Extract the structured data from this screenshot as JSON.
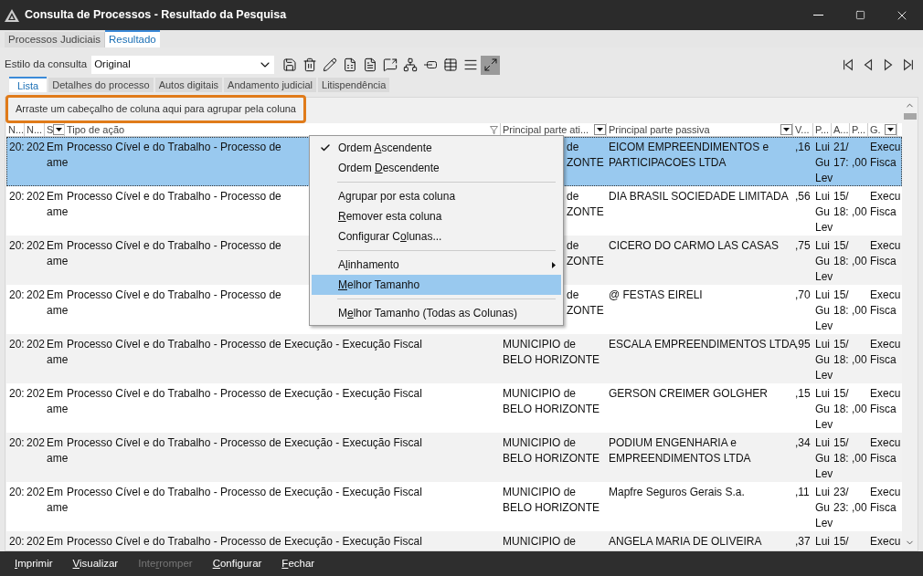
{
  "window": {
    "title": "Consulta de Processos - Resultado da Pesquisa"
  },
  "tabs": [
    {
      "label": "Processos Judiciais",
      "selected": false
    },
    {
      "label": "Resultado",
      "selected": true
    }
  ],
  "toolbar": {
    "style_label": "Estilo da consulta",
    "style_value": "Original",
    "tools": [
      {
        "kind": "save",
        "pressed": false
      },
      {
        "kind": "trash",
        "pressed": false
      },
      {
        "kind": "pencil",
        "pressed": false
      },
      {
        "kind": "sheet",
        "pressed": false
      },
      {
        "kind": "document",
        "pressed": false
      },
      {
        "kind": "comment",
        "pressed": false
      },
      {
        "kind": "tree",
        "pressed": false
      },
      {
        "kind": "minus",
        "pressed": false
      },
      {
        "kind": "table",
        "pressed": false
      },
      {
        "kind": "list",
        "pressed": false
      },
      {
        "kind": "fit",
        "pressed": true
      }
    ],
    "nav": [
      {
        "kind": "first"
      },
      {
        "kind": "prev"
      },
      {
        "kind": "next"
      },
      {
        "kind": "last"
      }
    ]
  },
  "subtabs": [
    {
      "label": "Lista",
      "selected": true
    },
    {
      "label": "Detalhes do processo",
      "selected": false
    },
    {
      "label": "Autos digitais",
      "selected": false
    },
    {
      "label": "Andamento judicial",
      "selected": false
    },
    {
      "label": "Litispendência",
      "selected": false
    }
  ],
  "group_hint": "Arraste um cabeçalho de coluna aqui para agrupar pela coluna",
  "columns": [
    {
      "label": "N...",
      "kind": "plain"
    },
    {
      "label": "N...",
      "kind": "plain"
    },
    {
      "label": "S",
      "kind": "dropdown"
    },
    {
      "label": "Tipo de ação",
      "kind": "filter"
    },
    {
      "label": "Principal parte ati...",
      "kind": "dropdown"
    },
    {
      "label": "Principal parte passiva",
      "kind": "dropdown"
    },
    {
      "label": "V...",
      "kind": "plain"
    },
    {
      "label": "P...",
      "kind": "plain"
    },
    {
      "label": "A...",
      "kind": "plain"
    },
    {
      "label": "P...",
      "kind": "plain"
    },
    {
      "label": "G.",
      "kind": "dropdown"
    }
  ],
  "rows": [
    {
      "selected": true,
      "cells": [
        [
          "20:"
        ],
        [
          "202"
        ],
        [
          "Em",
          "ame"
        ],
        [
          "Processo Cível e do Trabalho - Processo de"
        ],
        [
          "de",
          "ZONTE"
        ],
        [
          "EICOM EMPREENDIMENTOS e",
          "PARTICIPACOES LTDA"
        ],
        [
          ",16"
        ],
        [
          "Lui",
          "Gu",
          "Lev"
        ],
        [
          "21/",
          "17:"
        ],
        [
          ",00"
        ],
        [
          "Execu",
          "Fisca"
        ]
      ]
    },
    {
      "selected": false,
      "cells": [
        [
          "20:"
        ],
        [
          "202"
        ],
        [
          "Em",
          "ame"
        ],
        [
          "Processo Cível e do Trabalho - Processo de"
        ],
        [
          "de",
          "ZONTE"
        ],
        [
          "DIA BRASIL SOCIEDADE LIMITADA"
        ],
        [
          ",56"
        ],
        [
          "Lui",
          "Gu",
          "Lev"
        ],
        [
          "15/",
          "18:"
        ],
        [
          ",00"
        ],
        [
          "Execu",
          "Fisca"
        ]
      ]
    },
    {
      "selected": false,
      "cells": [
        [
          "20:"
        ],
        [
          "202"
        ],
        [
          "Em",
          "ame"
        ],
        [
          "Processo Cível e do Trabalho - Processo de"
        ],
        [
          "de",
          "ZONTE"
        ],
        [
          "CICERO DO CARMO LAS CASAS"
        ],
        [
          ",75"
        ],
        [
          "Lui",
          "Gu",
          "Lev"
        ],
        [
          "15/",
          "18:"
        ],
        [
          ",00"
        ],
        [
          "Execu",
          "Fisca"
        ]
      ]
    },
    {
      "selected": false,
      "cells": [
        [
          "20:"
        ],
        [
          "202"
        ],
        [
          "Em",
          "ame"
        ],
        [
          "Processo Cível e do Trabalho - Processo de"
        ],
        [
          "de",
          "ZONTE"
        ],
        [
          "@ FESTAS EIRELI"
        ],
        [
          ",70"
        ],
        [
          "Lui",
          "Gu",
          "Lev"
        ],
        [
          "15/",
          "18:"
        ],
        [
          ",00"
        ],
        [
          "Execu",
          "Fisca"
        ]
      ]
    },
    {
      "selected": false,
      "cells": [
        [
          "20:"
        ],
        [
          "202"
        ],
        [
          "Em",
          "ame"
        ],
        [
          "Processo Cível e do Trabalho - Processo de Execução - Execução Fiscal"
        ],
        [
          "MUNICIPIO de",
          "BELO HORIZONTE"
        ],
        [
          "ESCALA EMPREENDIMENTOS LTDA"
        ],
        [
          ",95"
        ],
        [
          "Lui",
          "Gu",
          "Lev"
        ],
        [
          "15/",
          "18:"
        ],
        [
          ",00"
        ],
        [
          "Execu",
          "Fisca"
        ]
      ]
    },
    {
      "selected": false,
      "cells": [
        [
          "20:"
        ],
        [
          "202"
        ],
        [
          "Em",
          "ame"
        ],
        [
          "Processo Cível e do Trabalho - Processo de Execução - Execução Fiscal"
        ],
        [
          "MUNICIPIO de",
          "BELO HORIZONTE"
        ],
        [
          "GERSON CREIMER GOLGHER"
        ],
        [
          ",15"
        ],
        [
          "Lui",
          "Gu",
          "Lev"
        ],
        [
          "15/",
          "18:"
        ],
        [
          ",00"
        ],
        [
          "Execu",
          "Fisca"
        ]
      ]
    },
    {
      "selected": false,
      "cells": [
        [
          "20:"
        ],
        [
          "202"
        ],
        [
          "Em",
          "ame"
        ],
        [
          "Processo Cível e do Trabalho - Processo de Execução - Execução Fiscal"
        ],
        [
          "MUNICIPIO de",
          "BELO HORIZONTE"
        ],
        [
          "PODIUM ENGENHARIA e",
          "EMPREENDIMENTOS LTDA"
        ],
        [
          ",34"
        ],
        [
          "Lui",
          "Gu",
          "Lev"
        ],
        [
          "15/",
          "18:"
        ],
        [
          ",00"
        ],
        [
          "Execu",
          "Fisca"
        ]
      ]
    },
    {
      "selected": false,
      "cells": [
        [
          "20:"
        ],
        [
          "202"
        ],
        [
          "Em",
          "ame"
        ],
        [
          "Processo Cível e do Trabalho - Processo de Execução - Execução Fiscal"
        ],
        [
          "MUNICIPIO de",
          "BELO HORIZONTE"
        ],
        [
          "Mapfre Seguros Gerais S.a."
        ],
        [
          ",11"
        ],
        [
          "Lui",
          "Gu",
          "Lev"
        ],
        [
          "23/",
          "23:"
        ],
        [
          ",00"
        ],
        [
          "Execu",
          "Fisca"
        ]
      ]
    },
    {
      "selected": false,
      "cells": [
        [
          "20:"
        ],
        [
          "202"
        ],
        [
          "Em"
        ],
        [
          "Processo Cível e do Trabalho - Processo de Execução - Execução Fiscal"
        ],
        [
          "MUNICIPIO de"
        ],
        [
          "ANGELA MARIA DE OLIVEIRA"
        ],
        [
          ",37"
        ],
        [
          "Lui"
        ],
        [
          "15/"
        ],
        null,
        [
          "Execu"
        ]
      ]
    }
  ],
  "menu": [
    {
      "kind": "item",
      "label": {
        "before": "Ordem ",
        "key": "A",
        "after": "scendente"
      },
      "checked": true,
      "selected": false,
      "submenu": false
    },
    {
      "kind": "item",
      "label": {
        "before": "Ordem ",
        "key": "D",
        "after": "escendente"
      },
      "checked": false,
      "selected": false,
      "submenu": false
    },
    {
      "kind": "separator"
    },
    {
      "kind": "item",
      "label": {
        "before": "A",
        "key": "g",
        "after": "rupar por esta coluna"
      },
      "checked": false,
      "selected": false,
      "submenu": false
    },
    {
      "kind": "item",
      "label": {
        "key": "R",
        "after": "emover esta coluna"
      },
      "checked": false,
      "selected": false,
      "submenu": false
    },
    {
      "kind": "item",
      "label": {
        "before": "Configurar C",
        "key": "o",
        "after": "lunas..."
      },
      "checked": false,
      "selected": false,
      "submenu": false
    },
    {
      "kind": "separator"
    },
    {
      "kind": "item",
      "label": {
        "before": "A",
        "key": "l",
        "after": "inhamento"
      },
      "checked": false,
      "selected": false,
      "submenu": true
    },
    {
      "kind": "item",
      "label": {
        "key": "M",
        "after": "elhor Tamanho"
      },
      "checked": false,
      "selected": true,
      "submenu": false
    },
    {
      "kind": "separator"
    },
    {
      "kind": "item",
      "label": {
        "before": "M",
        "key": "e",
        "after": "lhor Tamanho (Todas as Colunas)"
      },
      "checked": false,
      "selected": false,
      "submenu": false
    }
  ],
  "bottom_buttons": [
    {
      "label": {
        "key": "I",
        "after": "mprimir"
      },
      "disabled": false
    },
    {
      "label": {
        "key": "V",
        "after": "isualizar"
      },
      "disabled": false
    },
    {
      "label": {
        "before": "Inte",
        "key": "r",
        "after": "romper"
      },
      "disabled": true
    },
    {
      "label": {
        "key": "C",
        "after": "onfigurar"
      },
      "disabled": false
    },
    {
      "label": {
        "key": "F",
        "after": "echar"
      },
      "disabled": false
    }
  ]
}
